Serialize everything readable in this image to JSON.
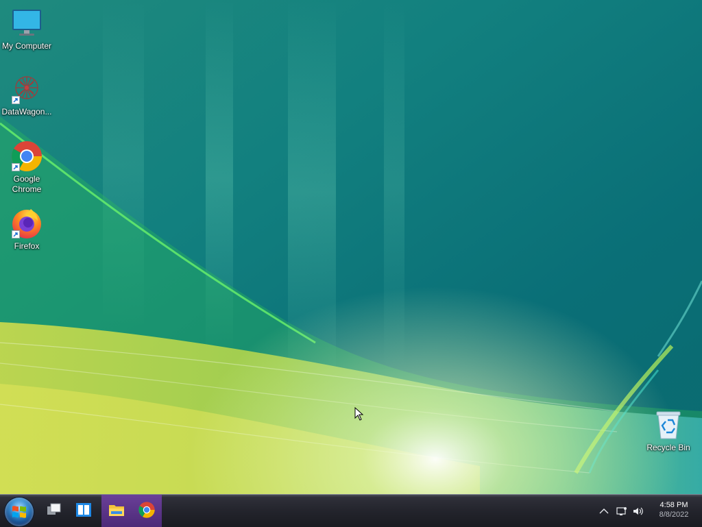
{
  "desktop": {
    "icons": [
      {
        "label": "My Computer",
        "icon": "monitor-icon"
      },
      {
        "label": "DataWagon...",
        "icon": "datawagon-icon",
        "shortcut": true
      },
      {
        "label": "Google Chrome",
        "icon": "chrome-icon",
        "shortcut": true
      },
      {
        "label": "Firefox",
        "icon": "firefox-icon",
        "shortcut": true
      },
      {
        "label": "Recycle Bin",
        "icon": "recycle-bin-icon"
      }
    ]
  },
  "taskbar": {
    "start_button": "windows-logo-icon",
    "pinned": [
      {
        "name": "show-desktop",
        "icon": "show-desktop-icon"
      },
      {
        "name": "task-view",
        "icon": "task-view-icon"
      },
      {
        "name": "file-explorer",
        "icon": "folder-icon",
        "active": true
      },
      {
        "name": "chrome",
        "icon": "chrome-icon",
        "active": true
      }
    ],
    "tray": {
      "icons": [
        "chevron-up-icon",
        "network-icon",
        "volume-icon"
      ],
      "time": "4:58 PM",
      "date": "8/8/2022"
    }
  },
  "colors": {
    "active_task": "#5a3489",
    "taskbar": "#23242c"
  }
}
